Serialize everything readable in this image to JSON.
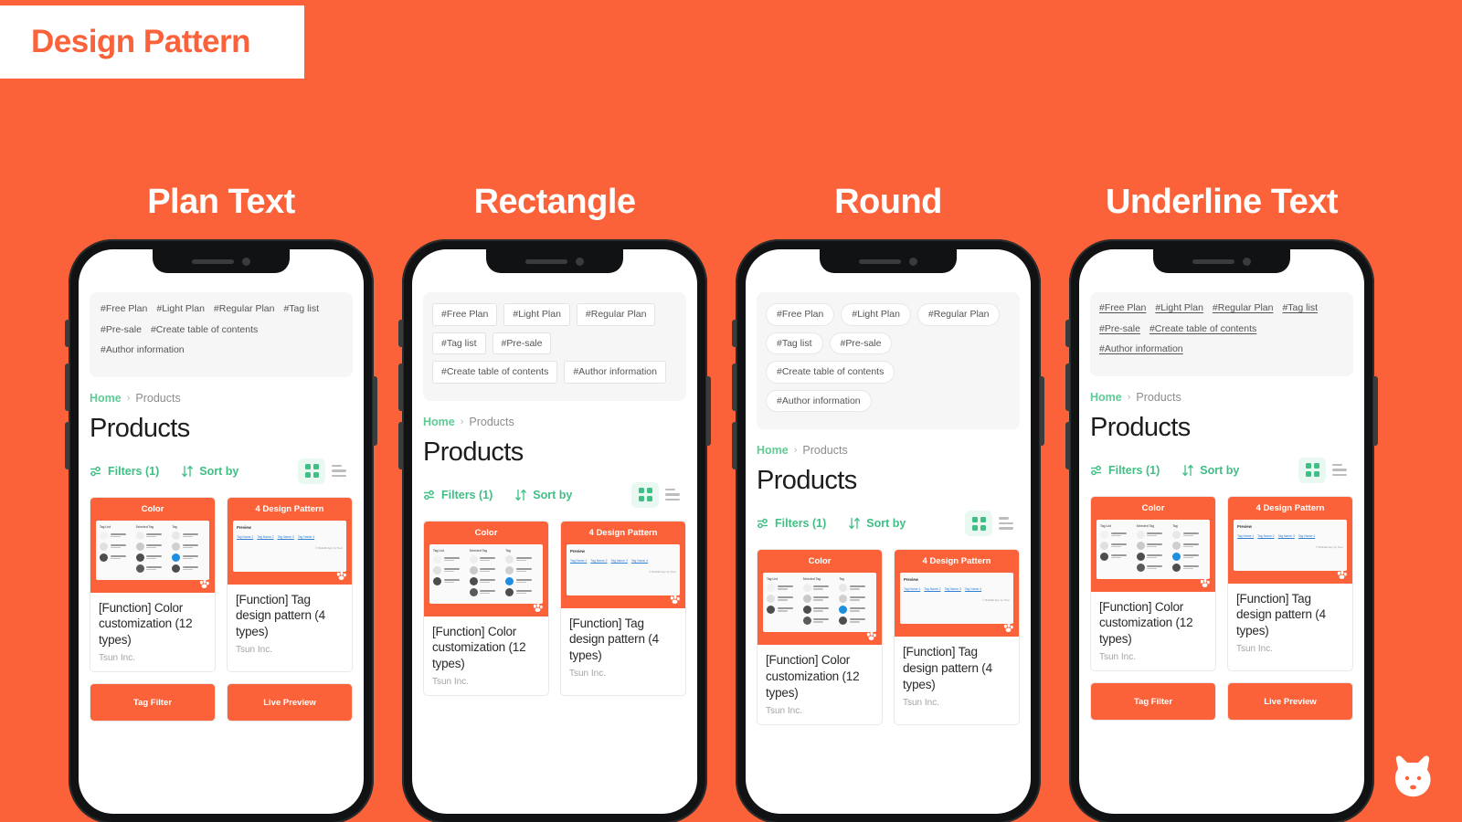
{
  "banner": {
    "title": "Design Pattern"
  },
  "theme": {
    "background": "#FB6239",
    "accent_green": "#3fbf84",
    "card_orange": "#FB6239",
    "banner_text": "#FB6239"
  },
  "columns": [
    {
      "heading": "Plan Text",
      "style": "plain"
    },
    {
      "heading": "Rectangle",
      "style": "rect"
    },
    {
      "heading": "Round",
      "style": "round"
    },
    {
      "heading": "Underline Text",
      "style": "underline"
    }
  ],
  "phone": {
    "tags": [
      "#Free Plan",
      "#Light Plan",
      "#Regular Plan",
      "#Tag list",
      "#Pre-sale",
      "#Create table of contents",
      "#Author information"
    ],
    "breadcrumb": {
      "home": "Home",
      "separator": "›",
      "current": "Products"
    },
    "page_title": "Products",
    "toolbar": {
      "filters_label": "Filters (1)",
      "sort_label": "Sort by",
      "grid_view_icon": "grid-view-icon",
      "list_view_icon": "list-view-icon",
      "active_view": "grid"
    },
    "products": [
      {
        "thumb_title": "Color",
        "title": "[Function] Color customization (12 types)",
        "vendor": "Tsun Inc.",
        "thumb_type": "swatches",
        "swatch_columns": [
          {
            "header": "Tag List",
            "dots": [
              "#f2f2f2",
              "#e0e0e0",
              "#4d4d4d"
            ]
          },
          {
            "header": "Selected Tag",
            "dots": [
              "#eeeeee",
              "#c9c9c9",
              "#4d4d4d",
              "#5a5a5a"
            ]
          },
          {
            "header": "Tag",
            "dots": [
              "#e8e8e8",
              "#cfcfcf",
              "#1e8fe0",
              "#4d4d4d"
            ]
          }
        ]
      },
      {
        "thumb_title": "4 Design Pattern",
        "title": "[Function] Tag design pattern (4 types)",
        "vendor": "Tsun Inc.",
        "thumb_type": "preview",
        "preview": {
          "header": "Preview",
          "tags": [
            "Tag Name 1",
            "Tag Name 2",
            "Tag Name 3",
            "Tag Name 4"
          ],
          "footer": "© Buildkit App by Tsun"
        }
      }
    ],
    "products_row2": [
      {
        "thumb_title": "Tag Filter"
      },
      {
        "thumb_title": "Live Preview"
      }
    ]
  },
  "corner_logo": "dog-head-logo"
}
